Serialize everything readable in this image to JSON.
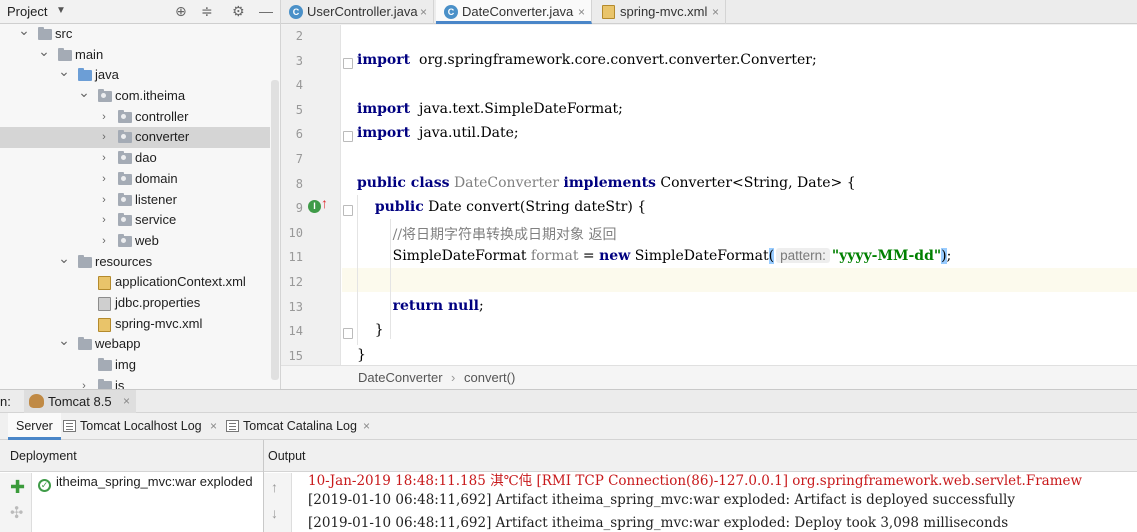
{
  "project": {
    "title": "Project",
    "tree": [
      {
        "label": "src",
        "depth": 0,
        "expanded": true,
        "icon": "folder",
        "selected": false
      },
      {
        "label": "main",
        "depth": 1,
        "expanded": true,
        "icon": "folder",
        "selected": false
      },
      {
        "label": "java",
        "depth": 2,
        "expanded": true,
        "icon": "source-folder",
        "selected": false
      },
      {
        "label": "com.itheima",
        "depth": 3,
        "expanded": true,
        "icon": "package",
        "selected": false
      },
      {
        "label": "controller",
        "depth": 4,
        "expanded": false,
        "icon": "package",
        "selected": false
      },
      {
        "label": "converter",
        "depth": 4,
        "expanded": false,
        "icon": "package",
        "selected": true
      },
      {
        "label": "dao",
        "depth": 4,
        "expanded": false,
        "icon": "package",
        "selected": false
      },
      {
        "label": "domain",
        "depth": 4,
        "expanded": false,
        "icon": "package",
        "selected": false
      },
      {
        "label": "listener",
        "depth": 4,
        "expanded": false,
        "icon": "package",
        "selected": false
      },
      {
        "label": "service",
        "depth": 4,
        "expanded": false,
        "icon": "package",
        "selected": false
      },
      {
        "label": "web",
        "depth": 4,
        "expanded": false,
        "icon": "package",
        "selected": false
      },
      {
        "label": "resources",
        "depth": 2,
        "expanded": true,
        "icon": "resources-folder",
        "selected": false
      },
      {
        "label": "applicationContext.xml",
        "depth": 3,
        "expanded": null,
        "icon": "xml-file",
        "selected": false
      },
      {
        "label": "jdbc.properties",
        "depth": 3,
        "expanded": null,
        "icon": "properties-file",
        "selected": false
      },
      {
        "label": "spring-mvc.xml",
        "depth": 3,
        "expanded": null,
        "icon": "xml-file",
        "selected": false
      },
      {
        "label": "webapp",
        "depth": 2,
        "expanded": true,
        "icon": "folder",
        "selected": false
      },
      {
        "label": "img",
        "depth": 3,
        "expanded": null,
        "icon": "folder",
        "selected": false
      },
      {
        "label": "js",
        "depth": 3,
        "expanded": false,
        "icon": "folder",
        "selected": false
      }
    ]
  },
  "editor_tabs": [
    {
      "label": "UserController.java",
      "icon": "class-icon",
      "active": false
    },
    {
      "label": "DateConverter.java",
      "icon": "class-icon",
      "active": true
    },
    {
      "label": "spring-mvc.xml",
      "icon": "xml-icon",
      "active": false
    }
  ],
  "code": {
    "lines": [
      {
        "n": "2",
        "parts": []
      },
      {
        "n": "3",
        "parts": [
          [
            "kw",
            "import"
          ],
          [
            "",
            "  org.springframework.core.convert.converter.Converter;"
          ]
        ]
      },
      {
        "n": "4",
        "parts": []
      },
      {
        "n": "5",
        "parts": [
          [
            "kw",
            "import"
          ],
          [
            "",
            "  java.text.SimpleDateFormat;"
          ]
        ]
      },
      {
        "n": "6",
        "parts": [
          [
            "kw",
            "import"
          ],
          [
            "",
            "  java.util.Date;"
          ]
        ]
      },
      {
        "n": "7",
        "parts": []
      },
      {
        "n": "8",
        "parts": [
          [
            "kw",
            "public class"
          ],
          [
            "",
            " "
          ],
          [
            "gray",
            "DateConverter"
          ],
          [
            "",
            " "
          ],
          [
            "kw",
            "implements"
          ],
          [
            "",
            " Converter<String, Date> {"
          ]
        ]
      },
      {
        "n": "9",
        "parts": [
          [
            "",
            "    "
          ],
          [
            "kw",
            "public"
          ],
          [
            "",
            " Date convert(String dateStr) {"
          ]
        ]
      },
      {
        "n": "10",
        "parts": [
          [
            "",
            "        "
          ],
          [
            "cmt",
            "//将日期字符串转换成日期对象 返回"
          ]
        ]
      },
      {
        "n": "11",
        "parts": [
          [
            "",
            "        SimpleDateFormat "
          ],
          [
            "gray",
            "format"
          ],
          [
            "",
            " = "
          ],
          [
            "kw",
            "new"
          ],
          [
            "",
            " SimpleDateFormat"
          ],
          [
            "paren",
            "("
          ],
          [
            "hint",
            "pattern:"
          ],
          [
            "str",
            "\"yyyy-MM-dd\""
          ],
          [
            "paren",
            ")"
          ],
          [
            "",
            ";"
          ]
        ]
      },
      {
        "n": "12",
        "parts": []
      },
      {
        "n": "13",
        "parts": [
          [
            "",
            "        "
          ],
          [
            "kw",
            "return null"
          ],
          [
            "",
            ";"
          ]
        ]
      },
      {
        "n": "14",
        "parts": [
          [
            "",
            "    }"
          ]
        ]
      },
      {
        "n": "15",
        "parts": [
          [
            "",
            "}"
          ]
        ]
      }
    ]
  },
  "breadcrumb": {
    "class_name": "DateConverter",
    "sep": "›",
    "method": "convert()"
  },
  "run": {
    "prefix": "n:",
    "config_tab": "Tomcat 8.5",
    "subtabs": [
      "Server",
      "Tomcat Localhost Log",
      "Tomcat Catalina Log"
    ],
    "deployment_header": "Deployment",
    "output_header": "Output",
    "deployment_item": "itheima_spring_mvc:war exploded",
    "output_lines": [
      {
        "text": "10-Jan-2019 18:48:11.185 淇℃伅 [RMI TCP Connection(86)-127.0.0.1] org.springframework.web.servlet.Framew",
        "err": true
      },
      {
        "text": "[2019-01-10 06:48:11,692] Artifact itheima_spring_mvc:war exploded: Artifact is deployed successfully",
        "err": false
      },
      {
        "text": "[2019-01-10 06:48:11,692] Artifact itheima_spring_mvc:war exploded: Deploy took 3,098 milliseconds",
        "err": false
      }
    ]
  }
}
